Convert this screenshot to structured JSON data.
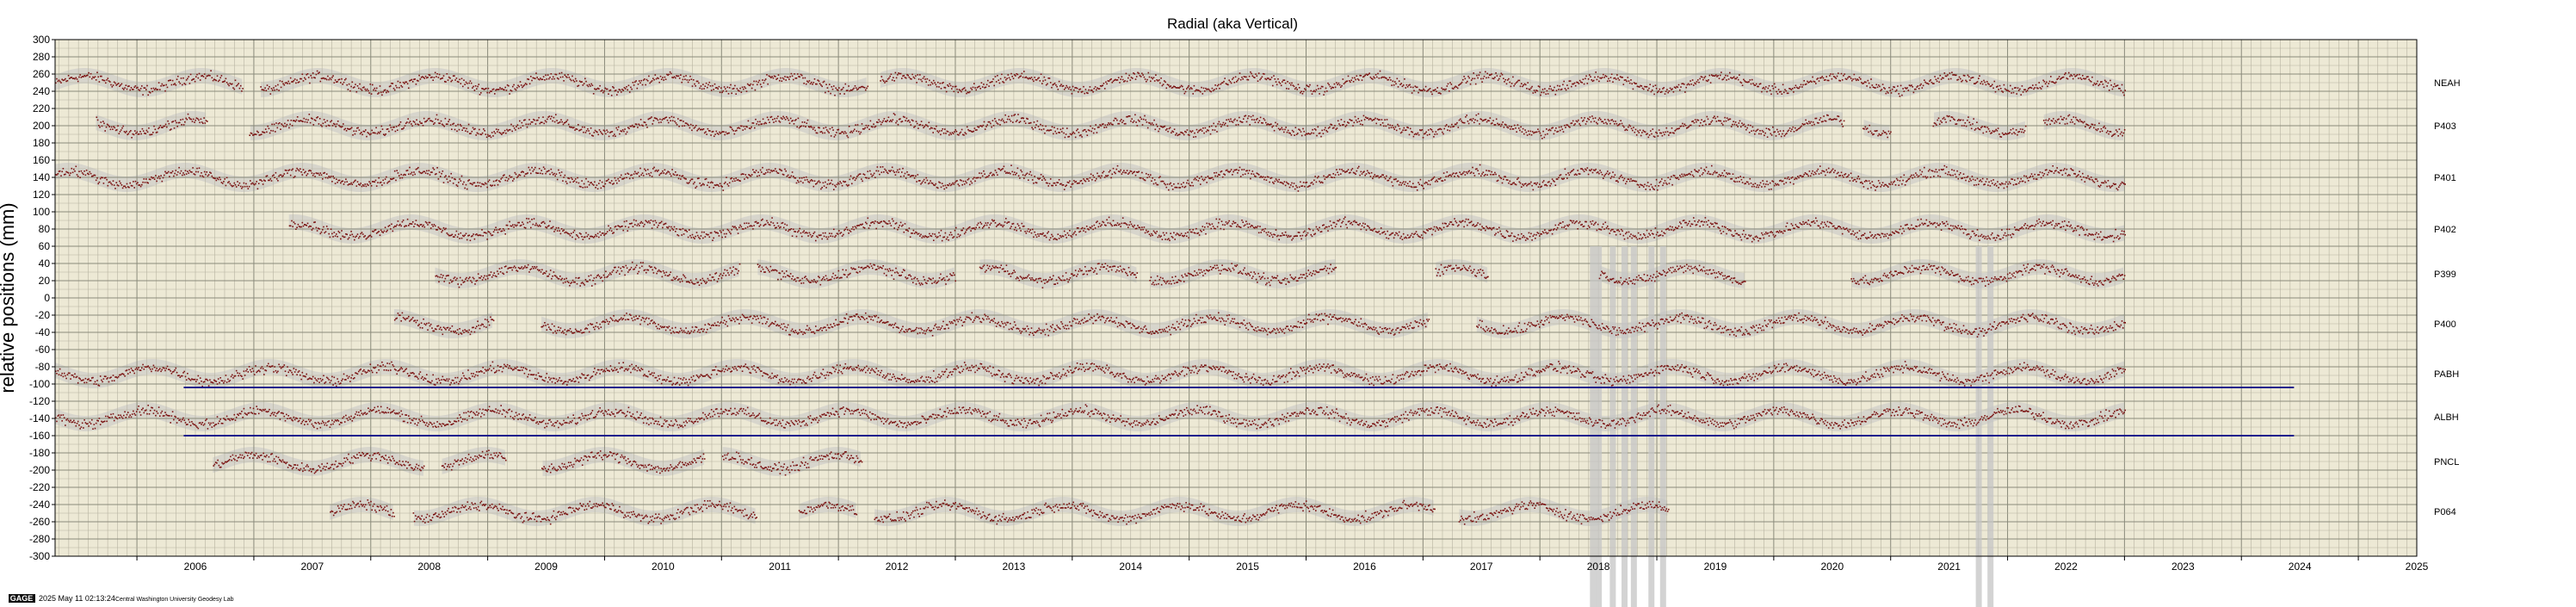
{
  "chart_data": {
    "type": "scatter",
    "title": "Radial (aka Vertical)",
    "ylabel": "relative positions (mm)",
    "xlabel": "",
    "xlim": [
      2005.3,
      2025.5
    ],
    "ylim": [
      -300,
      300
    ],
    "y_ticks": [
      300,
      280,
      260,
      240,
      220,
      200,
      180,
      160,
      140,
      120,
      100,
      80,
      60,
      40,
      20,
      0,
      -20,
      -40,
      -60,
      -80,
      -100,
      -120,
      -140,
      -160,
      -180,
      -200,
      -220,
      -240,
      -260,
      -280,
      -300
    ],
    "x_ticks": [
      "2006",
      "2007",
      "2008",
      "2009",
      "2010",
      "2011",
      "2012",
      "2013",
      "2014",
      "2015",
      "2016",
      "2017",
      "2018",
      "2019",
      "2020",
      "2021",
      "2022",
      "2023",
      "2024",
      "2025"
    ],
    "grid": true,
    "background_color": "#ede9d5",
    "point_color": "#7a1212",
    "band_color": "#c4c4c4",
    "line_color": "#1a1a8c",
    "series": [
      {
        "name": "NEAH",
        "offset": 250,
        "start": 2005.3,
        "end": 2023.0,
        "gaps": [
          [
            2006.9,
            2007.05
          ],
          [
            2012.25,
            2012.35
          ]
        ]
      },
      {
        "name": "P403",
        "offset": 200,
        "start": 2005.65,
        "end": 2023.0,
        "gaps": [
          [
            2006.6,
            2006.95
          ],
          [
            2020.6,
            2020.75
          ],
          [
            2021.0,
            2021.35
          ],
          [
            2022.15,
            2022.3
          ]
        ]
      },
      {
        "name": "P401",
        "offset": 140,
        "start": 2005.3,
        "end": 2023.0,
        "gaps": []
      },
      {
        "name": "P402",
        "offset": 80,
        "start": 2007.3,
        "end": 2023.0,
        "gaps": []
      },
      {
        "name": "P399",
        "offset": 28,
        "start": 2008.55,
        "end": 2023.0,
        "gaps": [
          [
            2011.15,
            2011.3
          ],
          [
            2013.0,
            2013.2
          ],
          [
            2014.55,
            2014.65
          ],
          [
            2016.25,
            2017.1
          ],
          [
            2017.55,
            2018.5
          ],
          [
            2019.75,
            2020.65
          ]
        ]
      },
      {
        "name": "P400",
        "offset": -30,
        "start": 2008.2,
        "end": 2023.0,
        "gaps": [
          [
            2009.05,
            2009.45
          ],
          [
            2017.05,
            2017.45
          ]
        ]
      },
      {
        "name": "PABH",
        "offset": -88,
        "start": 2005.3,
        "end": 2023.0,
        "gaps": []
      },
      {
        "name": "ALBH",
        "offset": -138,
        "start": 2005.3,
        "end": 2023.0,
        "gaps": []
      },
      {
        "name": "PNCL",
        "offset": -190,
        "start": 2006.65,
        "end": 2012.2,
        "gaps": [
          [
            2008.45,
            2008.6
          ],
          [
            2009.15,
            2009.45
          ],
          [
            2010.85,
            2011.0
          ]
        ]
      },
      {
        "name": "P064",
        "offset": -248,
        "start": 2007.65,
        "end": 2019.1,
        "gaps": [
          [
            2008.2,
            2008.35
          ],
          [
            2011.3,
            2011.65
          ],
          [
            2012.15,
            2012.3
          ],
          [
            2017.1,
            2017.3
          ]
        ]
      }
    ],
    "reference_lines": [
      {
        "y": -104,
        "x_start": 2006.4,
        "x_end": 2024.45
      },
      {
        "y": -160,
        "x_start": 2006.4,
        "x_end": 2024.45
      }
    ],
    "anomaly_spikes": [
      2018.45,
      2018.5,
      2018.62,
      2018.72,
      2018.8,
      2018.95,
      2019.05,
      2021.75,
      2021.85
    ]
  },
  "footer": {
    "badge": "GAGE",
    "timestamp": "2025 May 11 02:13:24",
    "credit": "Central Washington University Geodesy Lab"
  }
}
